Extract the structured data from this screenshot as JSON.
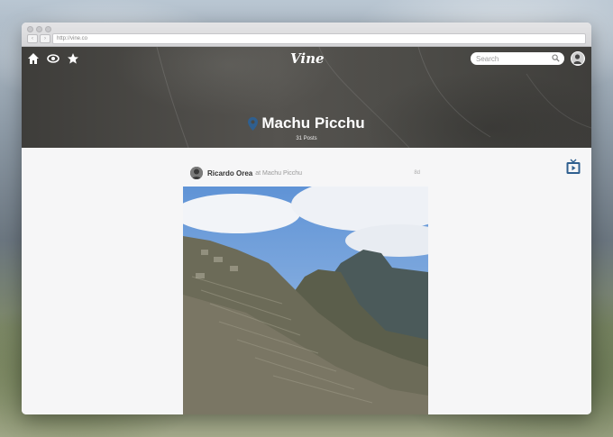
{
  "browser": {
    "url": "http://vine.co"
  },
  "topbar": {
    "home_icon": "home-icon",
    "explore_icon": "eye-icon",
    "popular_icon": "star-icon",
    "logo": "Vine",
    "search_placeholder": "Search",
    "search_icon": "magnifier-icon"
  },
  "venue": {
    "name": "Machu Picchu",
    "posts": "31 Posts",
    "pin_icon": "location-pin-icon"
  },
  "post": {
    "user": "Ricardo Orea",
    "at_label": "at Machu Picchu",
    "time": "8d"
  },
  "colors": {
    "accent": "#2f5f8f",
    "header_bg": "#4a4945"
  },
  "side": {
    "tv_icon": "tv-icon"
  }
}
